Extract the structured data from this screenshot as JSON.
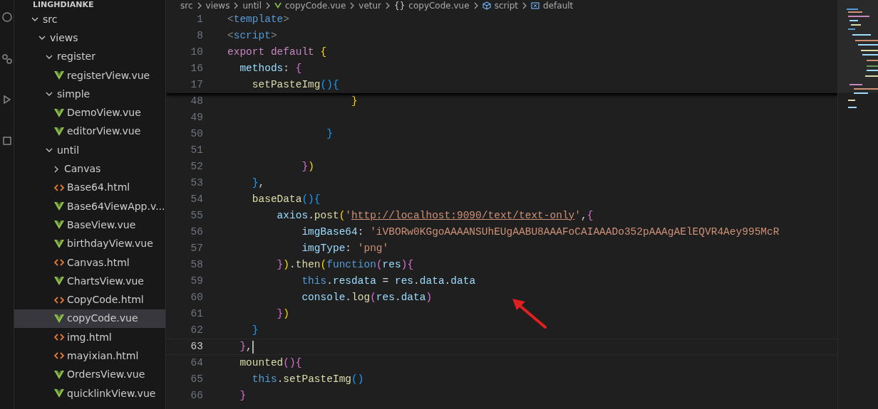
{
  "explorer": {
    "project": "LINGHDIANKE",
    "tree": [
      {
        "label": "src",
        "kind": "folder",
        "expanded": true,
        "selected": false,
        "children": [
          {
            "label": "views",
            "kind": "folder",
            "expanded": true,
            "selected": false,
            "children": [
              {
                "label": "register",
                "kind": "folder",
                "expanded": true,
                "selected": false,
                "children": [
                  {
                    "label": "registerView.vue",
                    "kind": "vue",
                    "selected": false
                  }
                ]
              },
              {
                "label": "simple",
                "kind": "folder",
                "expanded": true,
                "selected": false,
                "children": [
                  {
                    "label": "DemoView.vue",
                    "kind": "vue",
                    "selected": false
                  },
                  {
                    "label": "editorView.vue",
                    "kind": "vue",
                    "selected": false
                  }
                ]
              },
              {
                "label": "until",
                "kind": "folder",
                "expanded": true,
                "selected": false,
                "children": [
                  {
                    "label": "Canvas",
                    "kind": "folder",
                    "expanded": false,
                    "selected": false
                  },
                  {
                    "label": "Base64.html",
                    "kind": "html",
                    "selected": false
                  },
                  {
                    "label": "Base64ViewApp.v...",
                    "kind": "vue",
                    "selected": false
                  },
                  {
                    "label": "BaseView.vue",
                    "kind": "vue",
                    "selected": false
                  },
                  {
                    "label": "birthdayView.vue",
                    "kind": "vue",
                    "selected": false
                  },
                  {
                    "label": "Canvas.html",
                    "kind": "html",
                    "selected": false
                  },
                  {
                    "label": "ChartsView.vue",
                    "kind": "vue",
                    "selected": false
                  },
                  {
                    "label": "CopyCode.html",
                    "kind": "html",
                    "selected": false
                  },
                  {
                    "label": "copyCode.vue",
                    "kind": "vue",
                    "selected": true
                  },
                  {
                    "label": "img.html",
                    "kind": "html",
                    "selected": false
                  },
                  {
                    "label": "mayixian.html",
                    "kind": "html",
                    "selected": false
                  },
                  {
                    "label": "OrdersView.vue",
                    "kind": "vue",
                    "selected": false
                  },
                  {
                    "label": "quicklinkView.vue",
                    "kind": "vue",
                    "selected": false
                  }
                ]
              }
            ]
          }
        ]
      }
    ]
  },
  "breadcrumb": [
    {
      "label": "src",
      "kind": "text"
    },
    {
      "label": "views",
      "kind": "text"
    },
    {
      "label": "until",
      "kind": "text"
    },
    {
      "label": "copyCode.vue",
      "kind": "vue"
    },
    {
      "label": "vetur",
      "kind": "text"
    },
    {
      "label": "copyCode.vue",
      "kind": "braces",
      "glyph": "{}"
    },
    {
      "label": "script",
      "kind": "module"
    },
    {
      "label": "default",
      "kind": "variable"
    }
  ],
  "sticky_lines": [
    {
      "number": "1",
      "tokens": [
        {
          "t": "<",
          "kind": "tagp"
        },
        {
          "t": "template",
          "kind": "tag"
        },
        {
          "t": ">",
          "kind": "tagp"
        }
      ]
    },
    {
      "number": "8",
      "tokens": [
        {
          "t": "<",
          "kind": "tagp"
        },
        {
          "t": "script",
          "kind": "tag"
        },
        {
          "t": ">",
          "kind": "tagp"
        }
      ]
    },
    {
      "number": "10",
      "tokens": [
        {
          "t": "export default ",
          "kind": "kw"
        },
        {
          "t": "{",
          "kind": "b1"
        }
      ]
    },
    {
      "number": "16",
      "tokens": [
        {
          "t": "  methods",
          "kind": "prop"
        },
        {
          "t": ": ",
          "kind": "plain"
        },
        {
          "t": "{",
          "kind": "b2"
        }
      ]
    },
    {
      "number": "17",
      "tokens": [
        {
          "t": "    setPasteImg",
          "kind": "fn"
        },
        {
          "t": "(){",
          "kind": "b3"
        }
      ]
    }
  ],
  "lines": [
    {
      "number": "48",
      "current": false,
      "tokens": [
        {
          "t": "                    }",
          "kind": "b1"
        }
      ]
    },
    {
      "number": "49",
      "current": false
    },
    {
      "number": "50",
      "current": false,
      "tokens": [
        {
          "t": "                }",
          "kind": "b3"
        }
      ]
    },
    {
      "number": "51",
      "current": false
    },
    {
      "number": "52",
      "current": false,
      "tokens": [
        {
          "t": "            }",
          "kind": "b2"
        },
        {
          "t": ")",
          "kind": "b1"
        }
      ]
    },
    {
      "number": "53",
      "current": false,
      "tokens": [
        {
          "t": "    }",
          "kind": "b3"
        },
        {
          "t": ",",
          "kind": "plain"
        }
      ]
    },
    {
      "number": "54",
      "current": false,
      "tokens": [
        {
          "t": "    baseData",
          "kind": "fn"
        },
        {
          "t": "(){",
          "kind": "b3"
        }
      ]
    },
    {
      "number": "55",
      "current": false,
      "tokens": [
        {
          "t": "        axios",
          "kind": "var"
        },
        {
          "t": ".",
          "kind": "plain"
        },
        {
          "t": "post",
          "kind": "fn"
        },
        {
          "t": "(",
          "kind": "b1"
        },
        {
          "t": "'",
          "kind": "str"
        },
        {
          "t": "http://localhost:9090/text/text-only",
          "kind": "link"
        },
        {
          "t": "'",
          "kind": "str"
        },
        {
          "t": ",",
          "kind": "plain"
        },
        {
          "t": "{",
          "kind": "b2"
        }
      ]
    },
    {
      "number": "56",
      "current": false,
      "tokens": [
        {
          "t": "            imgBase64",
          "kind": "prop"
        },
        {
          "t": ": ",
          "kind": "plain"
        },
        {
          "t": "'iVBORw0KGgoAAAANSUhEUgAABU8AAAFoCAIAAADo352pAAAgAElEQVR4Aey995McR",
          "kind": "str"
        }
      ]
    },
    {
      "number": "57",
      "current": false,
      "tokens": [
        {
          "t": "            imgType",
          "kind": "prop"
        },
        {
          "t": ": ",
          "kind": "plain"
        },
        {
          "t": "'png'",
          "kind": "str"
        }
      ]
    },
    {
      "number": "58",
      "current": false,
      "tokens": [
        {
          "t": "        }",
          "kind": "b2"
        },
        {
          "t": ")",
          "kind": "b1"
        },
        {
          "t": ".",
          "kind": "plain"
        },
        {
          "t": "then",
          "kind": "fn"
        },
        {
          "t": "(",
          "kind": "b1"
        },
        {
          "t": "function",
          "kind": "kwb"
        },
        {
          "t": "(",
          "kind": "b2"
        },
        {
          "t": "res",
          "kind": "var"
        },
        {
          "t": "){",
          "kind": "b2"
        }
      ]
    },
    {
      "number": "59",
      "current": false,
      "tokens": [
        {
          "t": "            this",
          "kind": "kwb"
        },
        {
          "t": ".",
          "kind": "plain"
        },
        {
          "t": "resdata",
          "kind": "var"
        },
        {
          "t": " = ",
          "kind": "plain"
        },
        {
          "t": "res",
          "kind": "var"
        },
        {
          "t": ".",
          "kind": "plain"
        },
        {
          "t": "data",
          "kind": "var"
        },
        {
          "t": ".",
          "kind": "plain"
        },
        {
          "t": "data",
          "kind": "var"
        }
      ]
    },
    {
      "number": "60",
      "current": false,
      "tokens": [
        {
          "t": "            console",
          "kind": "var"
        },
        {
          "t": ".",
          "kind": "plain"
        },
        {
          "t": "log",
          "kind": "fn"
        },
        {
          "t": "(",
          "kind": "b2"
        },
        {
          "t": "res",
          "kind": "var"
        },
        {
          "t": ".",
          "kind": "plain"
        },
        {
          "t": "data",
          "kind": "var"
        },
        {
          "t": ")",
          "kind": "b2"
        }
      ]
    },
    {
      "number": "61",
      "current": false,
      "tokens": [
        {
          "t": "        }",
          "kind": "b2"
        },
        {
          "t": ")",
          "kind": "b1"
        }
      ]
    },
    {
      "number": "62",
      "current": false,
      "tokens": [
        {
          "t": "    }",
          "kind": "b3"
        }
      ]
    },
    {
      "number": "63",
      "current": true,
      "tokens": [
        {
          "t": "  }",
          "kind": "b2"
        },
        {
          "t": ",",
          "kind": "plain"
        }
      ]
    },
    {
      "number": "64",
      "current": false,
      "tokens": [
        {
          "t": "  mounted",
          "kind": "fn"
        },
        {
          "t": "(){",
          "kind": "b2"
        }
      ]
    },
    {
      "number": "65",
      "current": false,
      "tokens": [
        {
          "t": "    this",
          "kind": "kwb"
        },
        {
          "t": ".",
          "kind": "plain"
        },
        {
          "t": "setPasteImg",
          "kind": "fn"
        },
        {
          "t": "()",
          "kind": "b3"
        }
      ]
    },
    {
      "number": "66",
      "current": false,
      "tokens": [
        {
          "t": "  }",
          "kind": "b2"
        }
      ]
    }
  ]
}
